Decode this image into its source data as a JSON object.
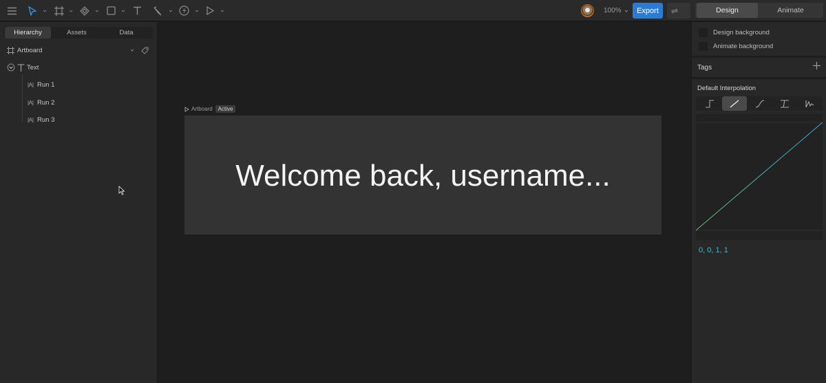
{
  "toolbar": {
    "zoom_label": "100%",
    "export_label": "Export",
    "swap_label": "⇌",
    "modes": [
      "Design",
      "Animate"
    ],
    "active_mode": "Design",
    "accent_color": "#2c7bd0"
  },
  "left_panel": {
    "tabs": [
      "Hierarchy",
      "Assets",
      "Data"
    ],
    "active_tab": "Hierarchy",
    "artboard_label": "Artboard",
    "tree": {
      "text_label": "Text",
      "runs": [
        "Run 1",
        "Run 2",
        "Run 3"
      ],
      "run_icon": "|A|"
    }
  },
  "canvas": {
    "artboard_label": "Artboard",
    "active_badge": "Active",
    "artboard_text": "Welcome back, username...",
    "artboard_color": "#333333"
  },
  "right_panel": {
    "design_background": "Design background",
    "animate_background": "Animate background",
    "tags_label": "Tags",
    "interpolation_title": "Default Interpolation",
    "interpolation_options": [
      "hold",
      "linear",
      "cubic",
      "elastic",
      "spring"
    ],
    "active_interpolation": "linear",
    "curve_value": "0, 0, 1, 1",
    "curve_color": "#3fb8cd"
  }
}
